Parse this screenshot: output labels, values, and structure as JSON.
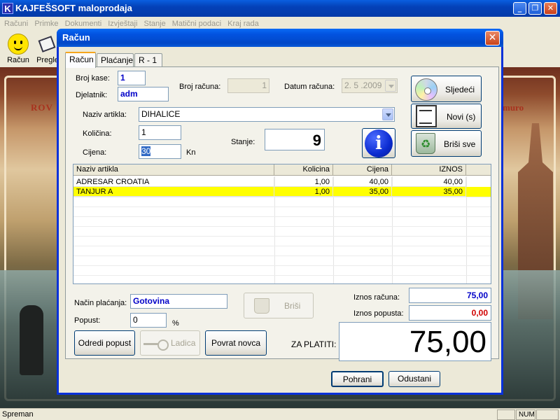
{
  "app": {
    "title": "KAJFEŠSOFT maloprodaja",
    "icon_letter": "K",
    "menu": [
      "Računi",
      "Primke",
      "Dokumenti",
      "Izvještaji",
      "Stanje",
      "Matični podaci",
      "Kraj rada"
    ],
    "toolbar": [
      {
        "label": "Račun",
        "icon": "smiley-icon"
      },
      {
        "label": "Pregle",
        "icon": "magnifier-icon"
      }
    ],
    "background_text_left": "ROV",
    "background_text_right": "muro",
    "status": {
      "message": "Spreman",
      "num": "NUM"
    }
  },
  "dialog": {
    "title": "Račun",
    "tabs": [
      "Račun",
      "Plaćanje",
      "R - 1"
    ],
    "labels": {
      "broj_kase": "Broj kase:",
      "djelatnik": "Djelatnik:",
      "broj_racuna": "Broj računa:",
      "datum_racuna": "Datum računa:",
      "naziv_artikla": "Naziv artikla:",
      "kolicina": "Količina:",
      "cijena": "Cijena:",
      "kn": "Kn",
      "stanje": "Stanje:",
      "nacin_placanja": "Način plaćanja:",
      "popust": "Popust:",
      "percent": "%",
      "iznos_racuna": "Iznos računa:",
      "iznos_popusta": "Iznos popusta:",
      "za_platiti": "ZA PLATITI:"
    },
    "values": {
      "broj_kase": "1",
      "djelatnik": "adm",
      "broj_racuna": "1",
      "datum_racuna": "2. 5 .2009",
      "naziv_artikla": "DIHALICE",
      "kolicina": "1",
      "cijena": "30",
      "stanje": "9",
      "nacin_placanja": "Gotovina",
      "popust": "0",
      "iznos_racuna": "75,00",
      "iznos_popusta": "0,00",
      "za_platiti": "75,00"
    },
    "buttons": {
      "sljedeci": "Sljedeći",
      "novi": "Novi (s)",
      "brisi_sve": "Briši sve",
      "brisi": "Briši",
      "odredi_popust": "Odredi popust",
      "ladica": "Ladica",
      "povrat_novca": "Povrat novca",
      "pohrani": "Pohrani",
      "odustani": "Odustani"
    },
    "table": {
      "columns": [
        "Naziv artikla",
        "Kolicina",
        "Cijena",
        "IZNOS"
      ],
      "rows": [
        [
          "ADRESAR CROATIA",
          "1,00",
          "40,00",
          "40,00"
        ],
        [
          "TANJUR A",
          "1,00",
          "35,00",
          "35,00"
        ]
      ],
      "selected_row": 1
    },
    "colors": {
      "iznos_racuna": "#0000c8",
      "iznos_popusta": "#d00000",
      "selected_row": "#ffff00"
    }
  }
}
